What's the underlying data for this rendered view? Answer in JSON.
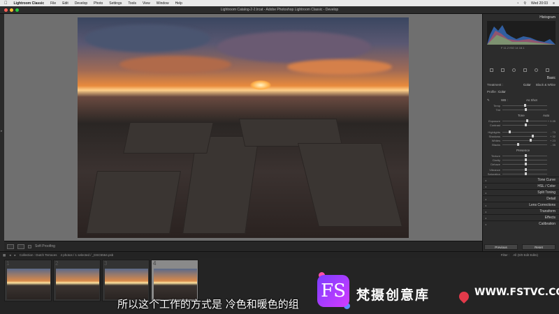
{
  "menubar": {
    "app": "Lightroom Classic",
    "items": [
      "File",
      "Edit",
      "Develop",
      "Photo",
      "Settings",
      "Tools",
      "View",
      "Window",
      "Help"
    ],
    "clock": "Wed 20:03"
  },
  "window": {
    "title": "Lightroom Catalog-2-2.lrcat - Adobe Photoshop Lightroom Classic - Develop"
  },
  "right_panel": {
    "histogram_label": "Histogram",
    "histogram_values": "F 11.2  ISO 14  16.1",
    "basic_label": "Basic",
    "treatment_label": "Treatment :",
    "color_label": "Color",
    "bw_label": "Black & White",
    "profile_label": "Profile :",
    "profile_value": "Color",
    "wb_label": "WB :",
    "wb_value": "As Shot",
    "temp_label": "Temp",
    "tint_label": "Tint",
    "tone_label": "Tone",
    "auto_label": "Auto",
    "exposure_label": "Exposure",
    "exposure_value": "+ 0.35",
    "contrast_label": "Contrast",
    "highlights_label": "Highlights",
    "highlights_value": "- 73",
    "shadows_label": "Shadows",
    "shadows_value": "+ 32",
    "whites_label": "Whites",
    "whites_value": "+ 23",
    "blacks_label": "Blacks",
    "blacks_value": "- 35",
    "presence_label": "Presence",
    "texture_label": "Texture",
    "clarity_label": "Clarity",
    "dehaze_label": "Dehaze",
    "vibrance_label": "Vibrance",
    "saturation_label": "Saturation",
    "sections": [
      "Tone Curve",
      "HSL / Color",
      "Split Toning",
      "Detail",
      "Lens Corrections",
      "Transform",
      "Effects",
      "Calibration"
    ],
    "previous_button": "Previous",
    "reset_button": "Reset"
  },
  "toolbar": {
    "soft_proofing": "Soft Proofing"
  },
  "filmbar": {
    "collection": "Collection : Dutch Terraces",
    "count": "4 photos / 1 selected / _DSC5564.psb",
    "filter_label": "Filter :",
    "filter_value": "All (0/0 Edit Edits)"
  },
  "filmstrip": {
    "thumbs": [
      {
        "num": "1"
      },
      {
        "num": "2"
      },
      {
        "num": "3"
      },
      {
        "num": "4"
      }
    ]
  },
  "watermark": {
    "logo_text": "FS",
    "brand": "梵摄创意库",
    "site": "WWW.FSTVC.CC"
  },
  "subtitle": "所以这个工作的方式是 冷色和暖色的组",
  "colors": {
    "accent": "#7b3cff",
    "panel": "#2c2c2c",
    "canvas": "#6f6f6f"
  }
}
